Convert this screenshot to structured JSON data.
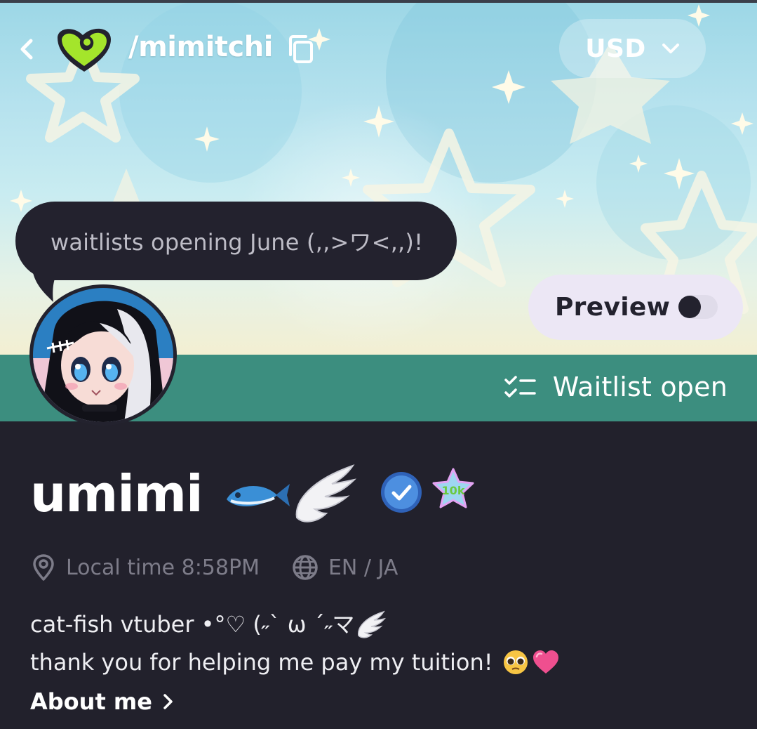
{
  "header": {
    "handle": "/mimitchi",
    "currency": "USD"
  },
  "banner": {
    "speech_bubble": "waitlists opening June (,,>ワ<,,)!"
  },
  "preview": {
    "label": "Preview",
    "enabled": false
  },
  "status": {
    "label": "Waitlist open"
  },
  "profile": {
    "display_name": "umimi",
    "local_time": "Local time 8:58PM",
    "languages": "EN / JA",
    "bio_line_1": "cat-fish vtuber •°♡ (˶ˋ ω ˊ˶マ",
    "bio_line_2": "thank you for helping me pay my tuition!",
    "badge_10k": "10k",
    "about_label": "About me"
  },
  "colors": {
    "background": "#22212c",
    "teal_bar": "#3c8e7f",
    "logo_green": "#a4e52b",
    "verified_blue": "#3f7fd8"
  },
  "icons": {
    "back": "chevron-left-icon",
    "copy": "copy-icon",
    "dropdown": "chevron-down-icon",
    "waitlist": "checklist-icon",
    "location": "location-pin-icon",
    "language": "globe-icon",
    "about": "chevron-right-icon"
  }
}
